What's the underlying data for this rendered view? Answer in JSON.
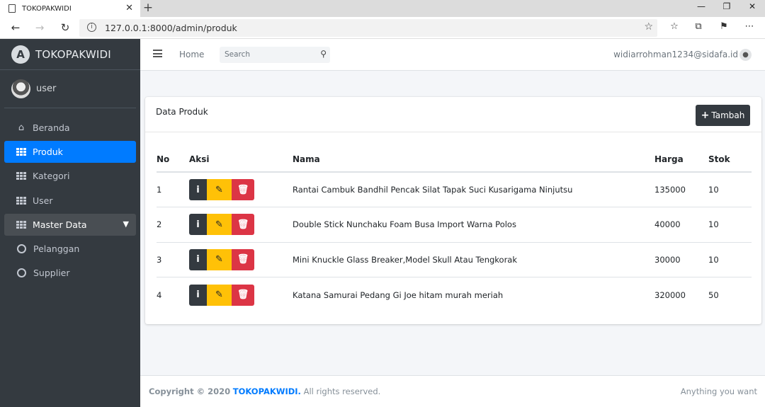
{
  "browser": {
    "tab_title": "TOKOPAKWIDI",
    "url": "127.0.0.1:8000/admin/produk"
  },
  "sidebar": {
    "brand": "TOKOPAKWIDI",
    "user": "user",
    "items": [
      {
        "label": "Beranda",
        "icon": "home-icon"
      },
      {
        "label": "Produk",
        "icon": "grid-icon",
        "active": true
      },
      {
        "label": "Kategori",
        "icon": "grid-icon"
      },
      {
        "label": "User",
        "icon": "grid-icon"
      },
      {
        "label": "Master Data",
        "icon": "grid-icon"
      },
      {
        "label": "Pelanggan",
        "icon": "circle-icon"
      },
      {
        "label": "Supplier",
        "icon": "circle-icon"
      }
    ]
  },
  "topnav": {
    "home": "Home",
    "search_placeholder": "Search",
    "email": "widiarrohman1234@sidafa.id"
  },
  "card": {
    "title": "Data Produk",
    "add_button": "Tambah",
    "columns": [
      "No",
      "Aksi",
      "Nama",
      "Harga",
      "Stok"
    ],
    "rows": [
      {
        "no": "1",
        "nama": "Rantai Cambuk Bandhil Pencak Silat Tapak Suci Kusarigama Ninjutsu",
        "harga": "135000",
        "stok": "10"
      },
      {
        "no": "2",
        "nama": "Double Stick Nunchaku Foam Busa Import Warna Polos",
        "harga": "40000",
        "stok": "10"
      },
      {
        "no": "3",
        "nama": "Mini Knuckle Glass Breaker,Model Skull Atau Tengkorak",
        "harga": "30000",
        "stok": "10"
      },
      {
        "no": "4",
        "nama": "Katana Samurai Pedang Gi Joe hitam murah meriah",
        "harga": "320000",
        "stok": "50"
      }
    ]
  },
  "footer": {
    "copyright_prefix": "Copyright © 2020",
    "brand": "TOKOPAKWIDI.",
    "suffix": "All rights reserved.",
    "right": "Anything you want"
  },
  "colors": {
    "sidebar": "#343a40",
    "active": "#007bff",
    "warning": "#ffc107",
    "danger": "#dc3545"
  }
}
